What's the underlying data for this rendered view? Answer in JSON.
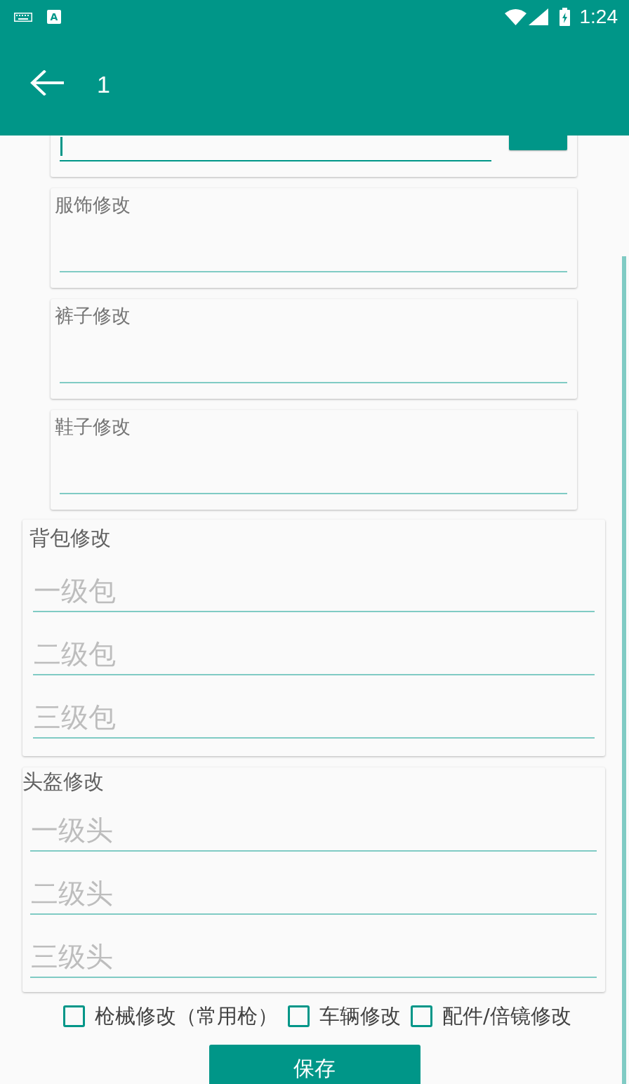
{
  "status_bar": {
    "input_badge": "A",
    "time": "1:24"
  },
  "app_bar": {
    "title": "1"
  },
  "top_card": {
    "field": {
      "focused": true
    }
  },
  "text_cards": [
    {
      "label": "服饰修改"
    },
    {
      "label": "裤子修改"
    },
    {
      "label": "鞋子修改"
    }
  ],
  "groups": [
    {
      "title": "背包修改",
      "fields": [
        {
          "placeholder": "一级包"
        },
        {
          "placeholder": "二级包"
        },
        {
          "placeholder": "三级包"
        }
      ]
    },
    {
      "title": "头盔修改",
      "fields": [
        {
          "placeholder": "一级头"
        },
        {
          "placeholder": "二级头"
        },
        {
          "placeholder": "三级头"
        }
      ]
    }
  ],
  "options": [
    {
      "label": "枪械修改（常用枪）",
      "checked": false
    },
    {
      "label": "车辆修改",
      "checked": false
    },
    {
      "label": "配件/倍镜修改",
      "checked": false
    }
  ],
  "save_button": {
    "label": "保存"
  }
}
